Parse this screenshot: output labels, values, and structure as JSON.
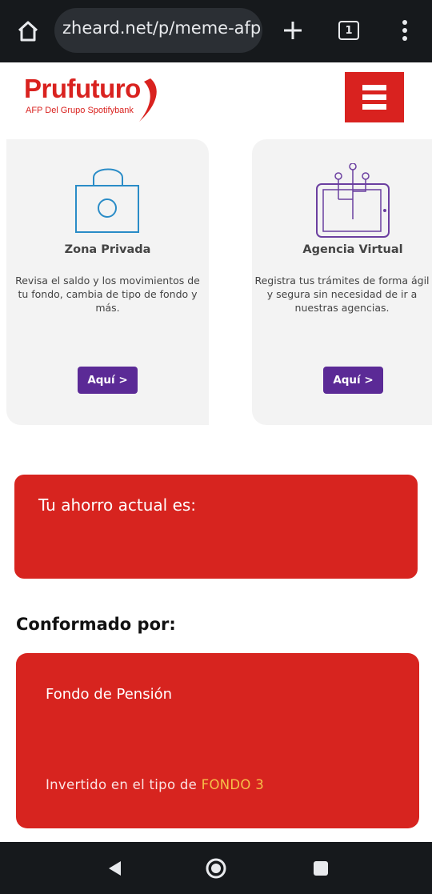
{
  "browser": {
    "url": "zheard.net/p/meme-afp",
    "tab_count": "1",
    "icons": {
      "home": "home-icon",
      "new_tab": "plus-icon",
      "tabs": "tab-switcher-icon",
      "menu": "more-vert-icon"
    }
  },
  "site": {
    "logo_name": "Prufuturo",
    "logo_subtitle": "AFP Del Grupo Spotifybank",
    "brand_color": "#d9221f",
    "menu_icon": "hamburger-menu-icon"
  },
  "cards": [
    {
      "title": "Zona Privada",
      "description": "Revisa el saldo y los movimientos de tu fondo, cambia de tipo de fondo y más.",
      "button": "Aquí >",
      "icon": "padlock-icon"
    },
    {
      "title": "Agencia Virtual",
      "description": "Registra tus trámites de forma ágil y segura sin necesidad de ir a nuestras agencias.",
      "button": "Aquí >",
      "icon": "tablet-circuit-icon"
    }
  ],
  "savings": {
    "label": "Tu ahorro actual es:",
    "amount": ""
  },
  "composition": {
    "title": "Conformado por:",
    "fund_title": "Fondo de Pensión",
    "invest_prefix": "Invertido en el tipo de",
    "fund_type": "FONDO 3"
  },
  "colors": {
    "accent_red": "#d7241f",
    "button_purple": "#5b2a96",
    "fund_type_yellow": "#f6c04a"
  },
  "system_nav": {
    "back": "back-icon",
    "home": "home-circle-icon",
    "recents": "recents-square-icon"
  }
}
